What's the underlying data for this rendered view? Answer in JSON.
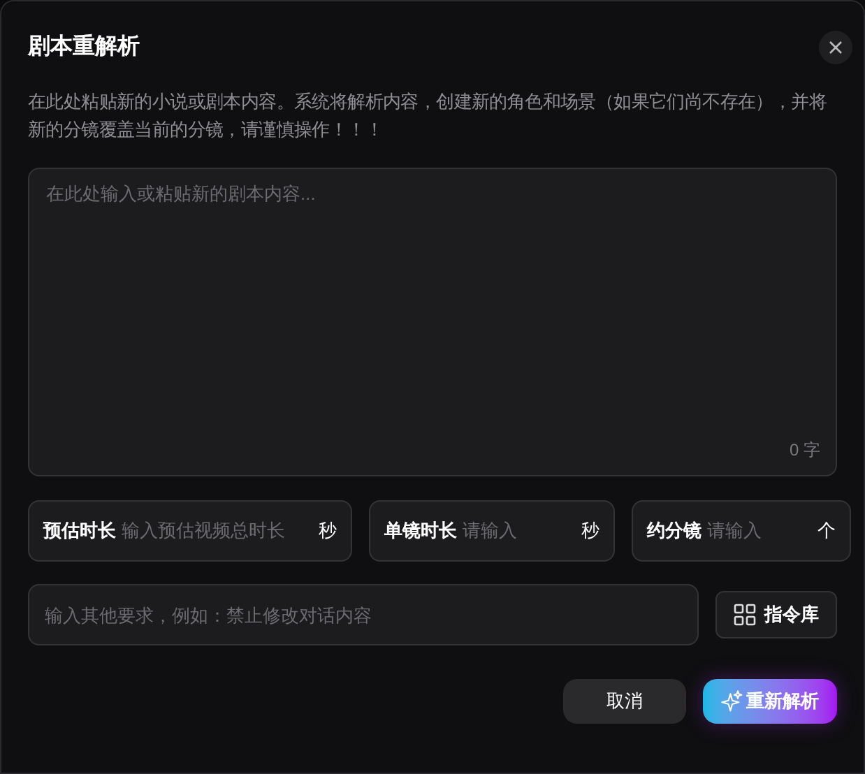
{
  "dialog": {
    "title": "剧本重解析",
    "description": "在此处粘贴新的小说或剧本内容。系统将解析内容，创建新的角色和场景（如果它们尚不存在），并将新的分镜覆盖当前的分镜，请谨慎操作！！！"
  },
  "script_input": {
    "placeholder": "在此处输入或粘贴新的剧本内容...",
    "count": "0 字"
  },
  "parameters": [
    {
      "label": "预估时长",
      "placeholder": "输入预估视频总时长",
      "unit": "秒"
    },
    {
      "label": "单镜时长",
      "placeholder": "请输入",
      "unit": "秒"
    },
    {
      "label": "约分镜",
      "placeholder": "请输入",
      "unit": "个"
    }
  ],
  "requirements": {
    "placeholder": "输入其他要求，例如：禁止修改对话内容"
  },
  "library_button": "指令库",
  "buttons": [
    {
      "kind": "secondary",
      "label": "取消"
    },
    {
      "kind": "primary",
      "label": "重新解析"
    }
  ]
}
